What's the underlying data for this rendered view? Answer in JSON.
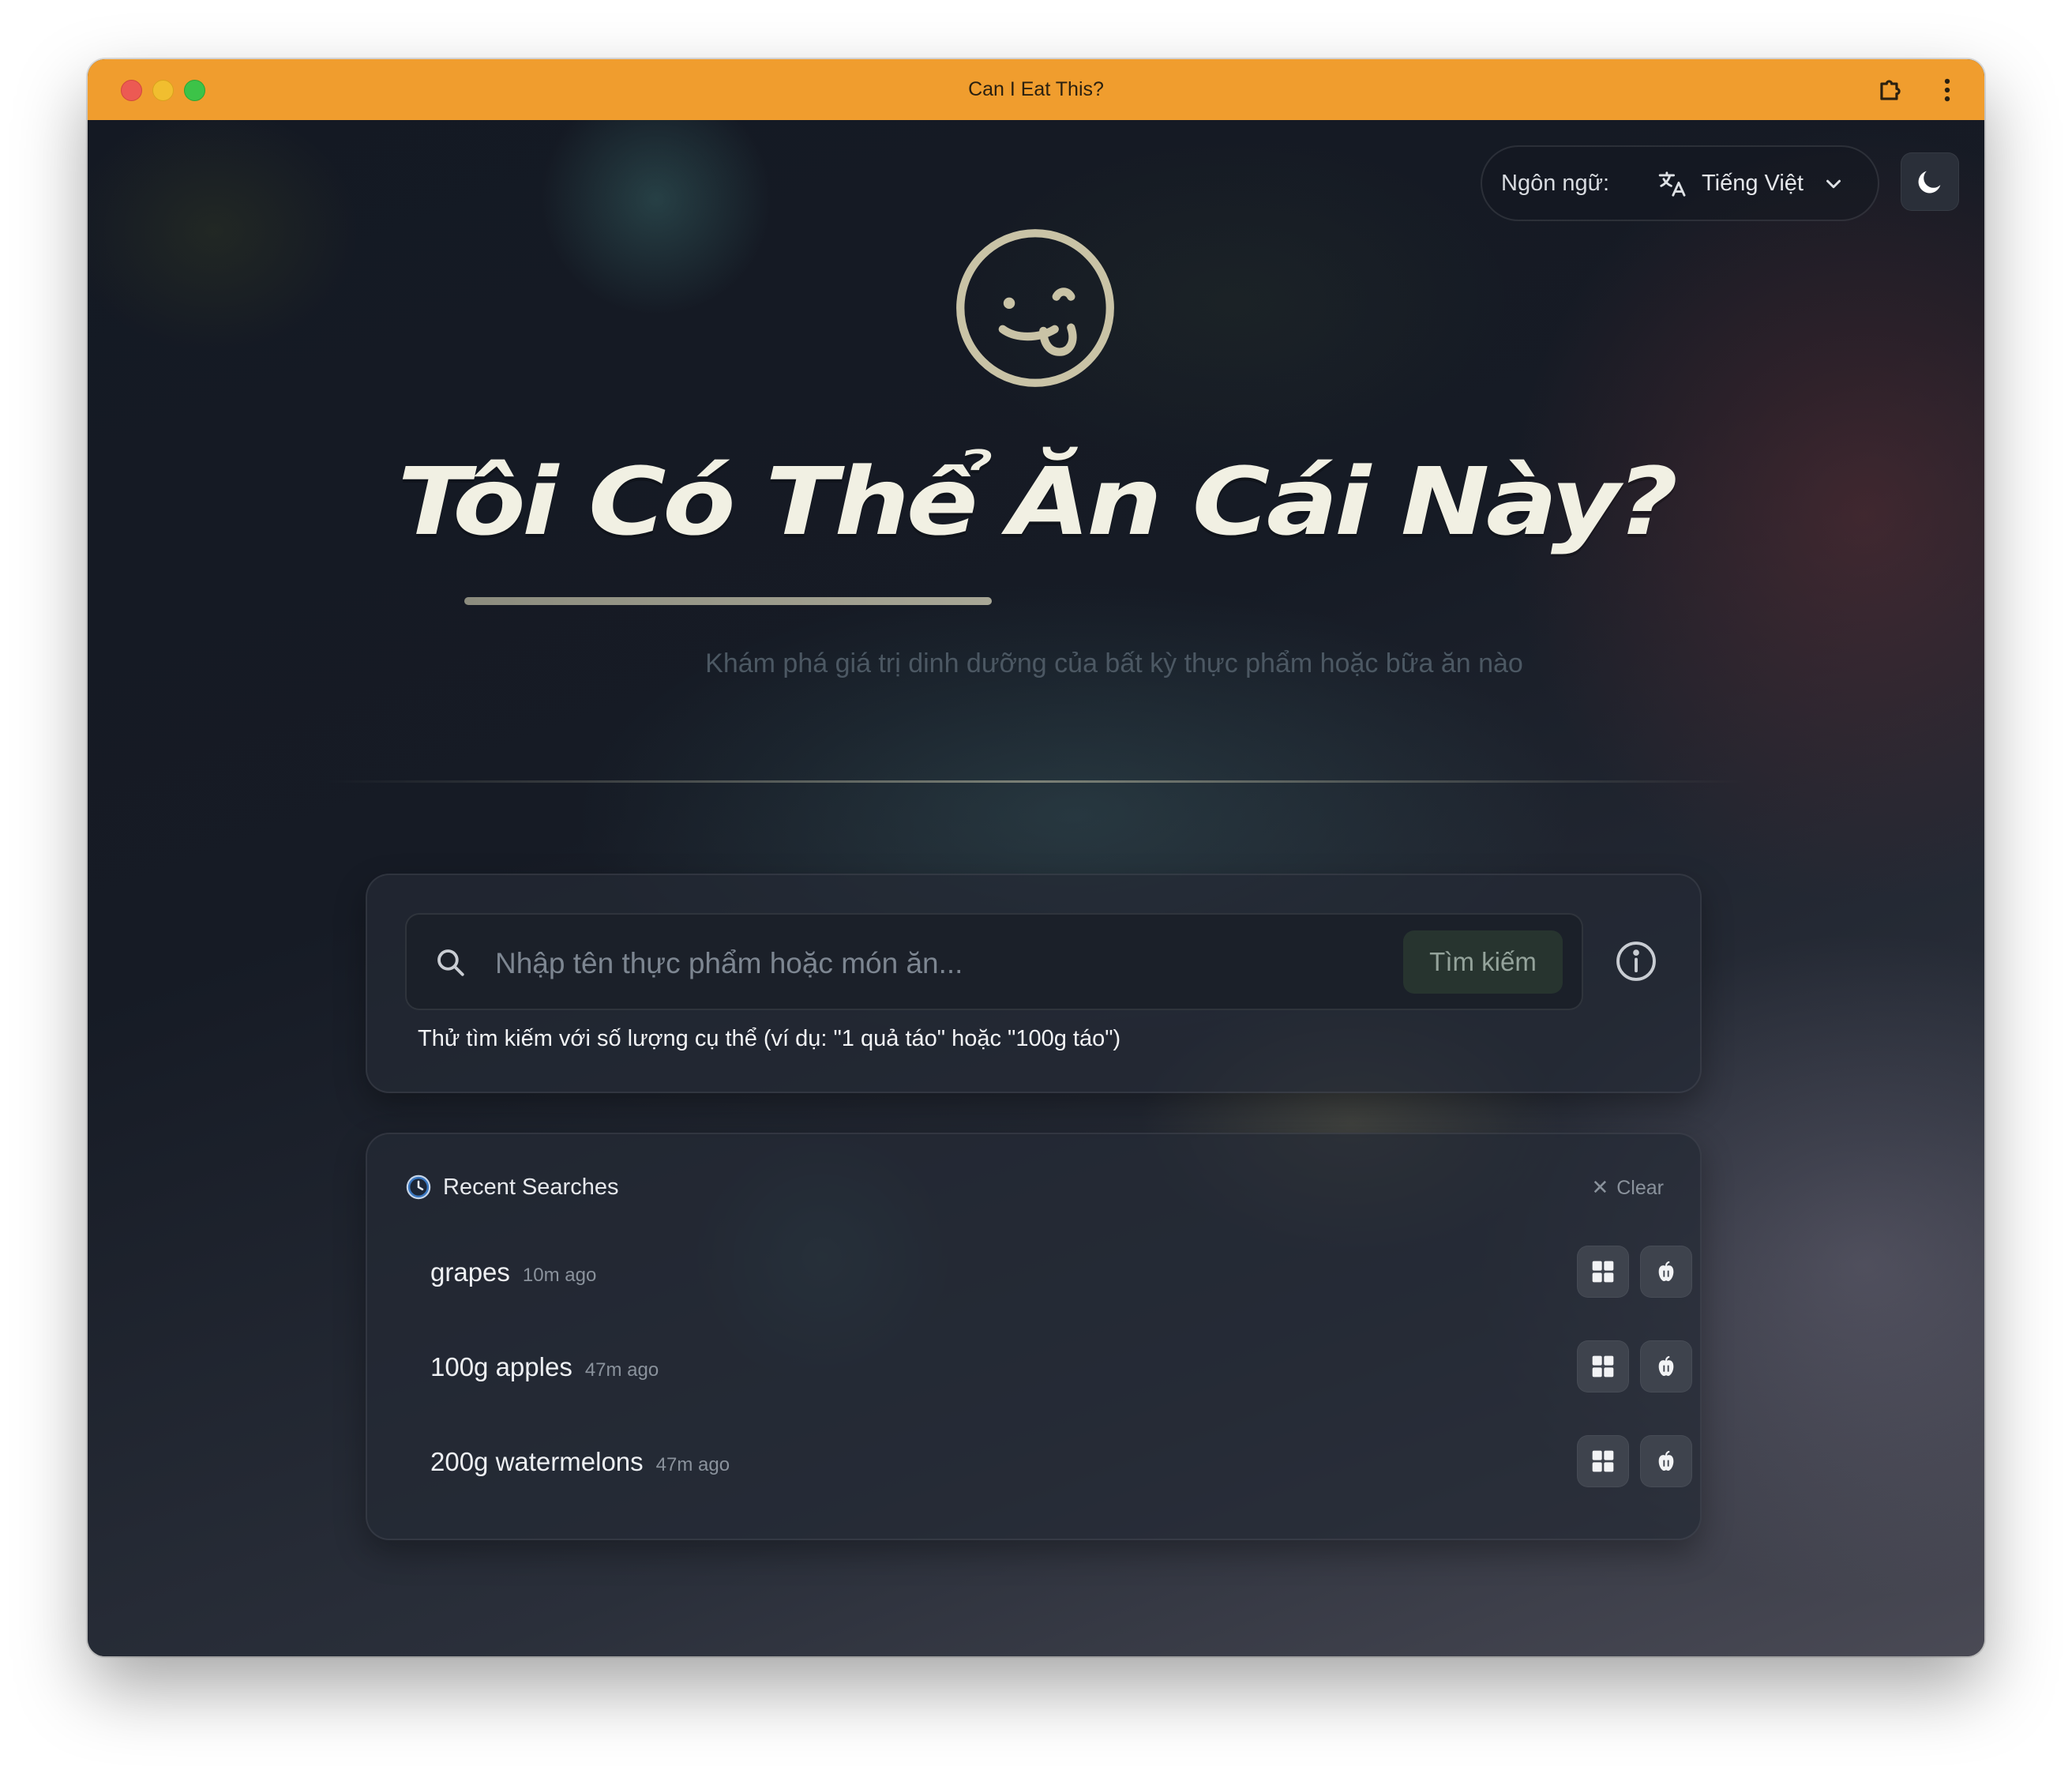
{
  "window": {
    "title": "Can I Eat This?"
  },
  "header": {
    "language_label": "Ngôn ngữ:",
    "language_value": "Tiếng Việt",
    "language_icon": "translate-icon",
    "theme_icon": "moon-icon"
  },
  "hero": {
    "logo_icon": "face-tongue-icon",
    "headline": "Tôi Có Thể Ăn Cái Này?",
    "subtitle": "Khám phá giá trị dinh dưỡng của bất kỳ thực phẩm hoặc bữa ăn nào"
  },
  "search": {
    "placeholder": "Nhập tên thực phẩm hoặc món ăn...",
    "value": "",
    "button_label": "Tìm kiếm",
    "hint": "Thử tìm kiếm với số lượng cụ thể (ví dụ: \"1 quả táo\" hoặc \"100g táo\")"
  },
  "recent": {
    "title": "Recent Searches",
    "clear_label": "Clear",
    "items": [
      {
        "query": "grapes",
        "time": "10m ago"
      },
      {
        "query": "100g apples",
        "time": "47m ago"
      },
      {
        "query": "200g watermelons",
        "time": "47m ago"
      }
    ]
  },
  "colors": {
    "titlebar": "#f09d2e",
    "background": "#141922",
    "headline": "#f1f0e3",
    "logo": "#c9c3a6"
  }
}
